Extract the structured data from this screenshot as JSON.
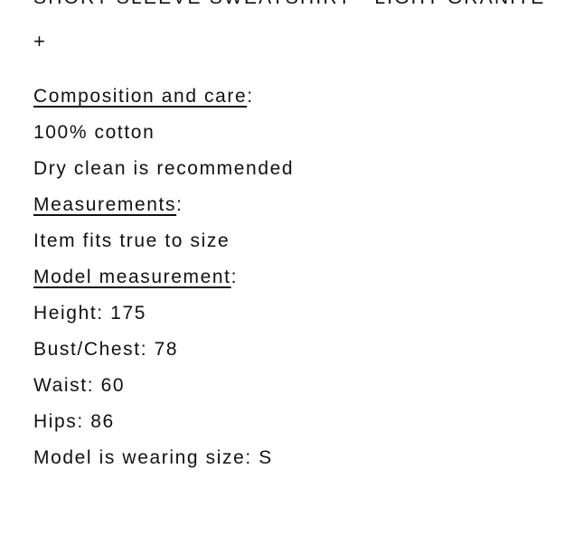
{
  "product": {
    "title": "SHORT SLEEVE SWEATSHIRT - LIGHT GRANITE",
    "expand_symbol": "+"
  },
  "details": {
    "composition_heading": "Composition and care",
    "heading_colon": ":",
    "composition_line1": "100% cotton",
    "composition_line2": "Dry clean is recommended",
    "measurements_heading": "Measurements",
    "measurements_line1": "Item fits true to size",
    "model_heading": "Model measurement",
    "model_height": "Height: 175",
    "model_bust": "Bust/Chest: 78",
    "model_waist": "Waist: 60",
    "model_hips": "Hips: 86",
    "model_size": "Model is wearing size: S"
  }
}
